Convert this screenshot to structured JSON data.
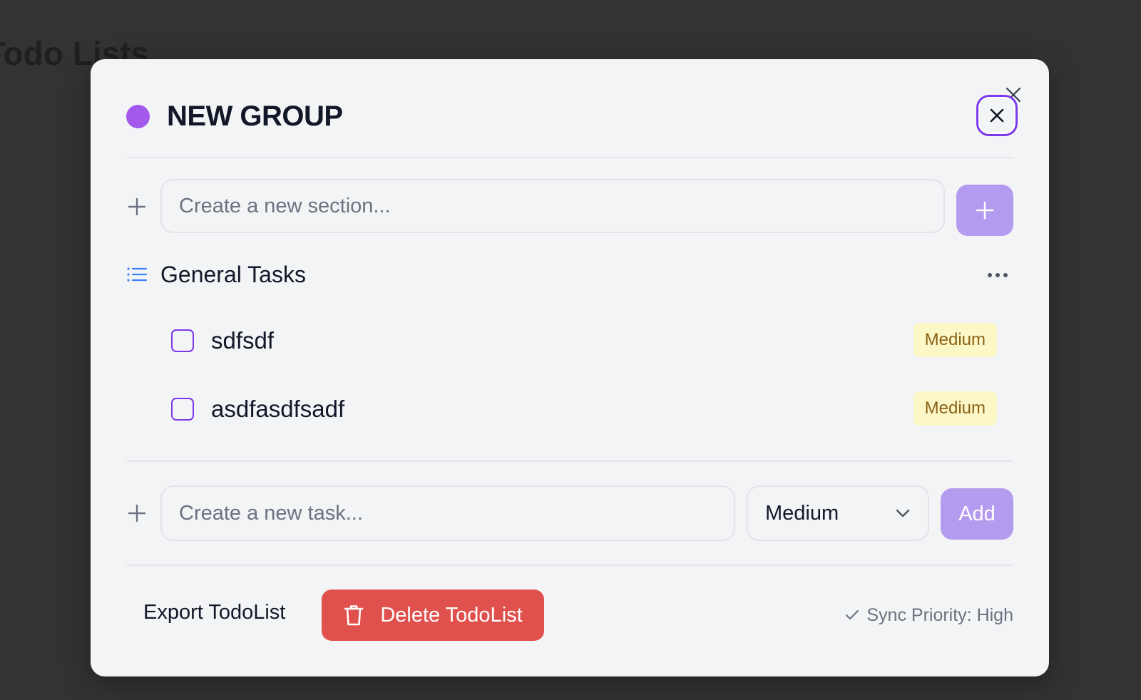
{
  "background": {
    "title": "Todo Lists"
  },
  "modal": {
    "group_color": "#a259ec",
    "title": "NEW GROUP",
    "section_input": {
      "placeholder": "Create a new section..."
    },
    "section": {
      "name": "General Tasks",
      "tasks": [
        {
          "text": "sdfsdf",
          "priority": "Medium",
          "checked": false
        },
        {
          "text": "asdfasdfsadf",
          "priority": "Medium",
          "checked": false
        }
      ]
    },
    "task_input": {
      "placeholder": "Create a new task..."
    },
    "priority_select": {
      "selected": "Medium"
    },
    "add_button": "Add",
    "export_button": "Export TodoList",
    "delete_button": "Delete TodoList",
    "sync_status": "Sync Priority: High"
  },
  "colors": {
    "accent": "#7c3aed",
    "accent_light": "#b39bef",
    "danger": "#e0504c",
    "badge_bg": "#fcf7c6",
    "badge_text": "#8a6117"
  }
}
